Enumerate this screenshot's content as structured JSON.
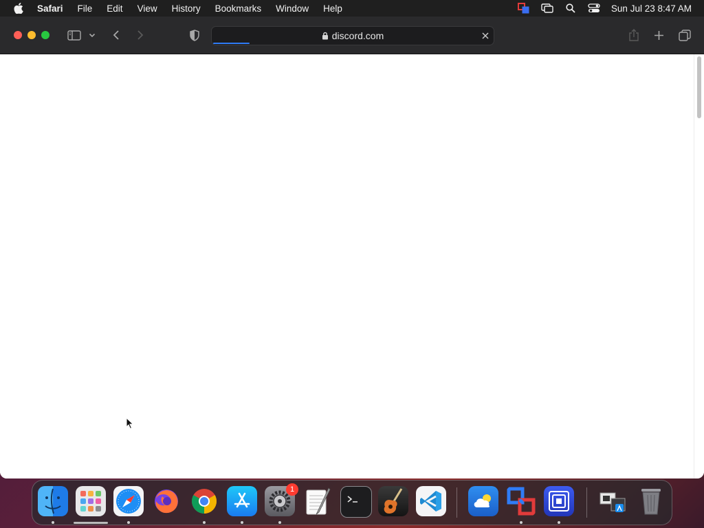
{
  "menubar": {
    "app_name": "Safari",
    "items": [
      "File",
      "Edit",
      "View",
      "History",
      "Bookmarks",
      "Window",
      "Help"
    ],
    "clock": "Sun Jul 23  8:47 AM"
  },
  "browser": {
    "url": "discord.com",
    "loading_progress": 0.13
  },
  "dock": {
    "apps": [
      "Finder",
      "Launchpad",
      "Safari",
      "Firefox",
      "Chrome",
      "App Store",
      "System Settings",
      "TextEdit",
      "Terminal",
      "GarageBand",
      "Visual Studio Code",
      "Weather",
      "Parallels",
      "Screens",
      "Downloads",
      "Trash"
    ],
    "settings_badge": "1"
  }
}
